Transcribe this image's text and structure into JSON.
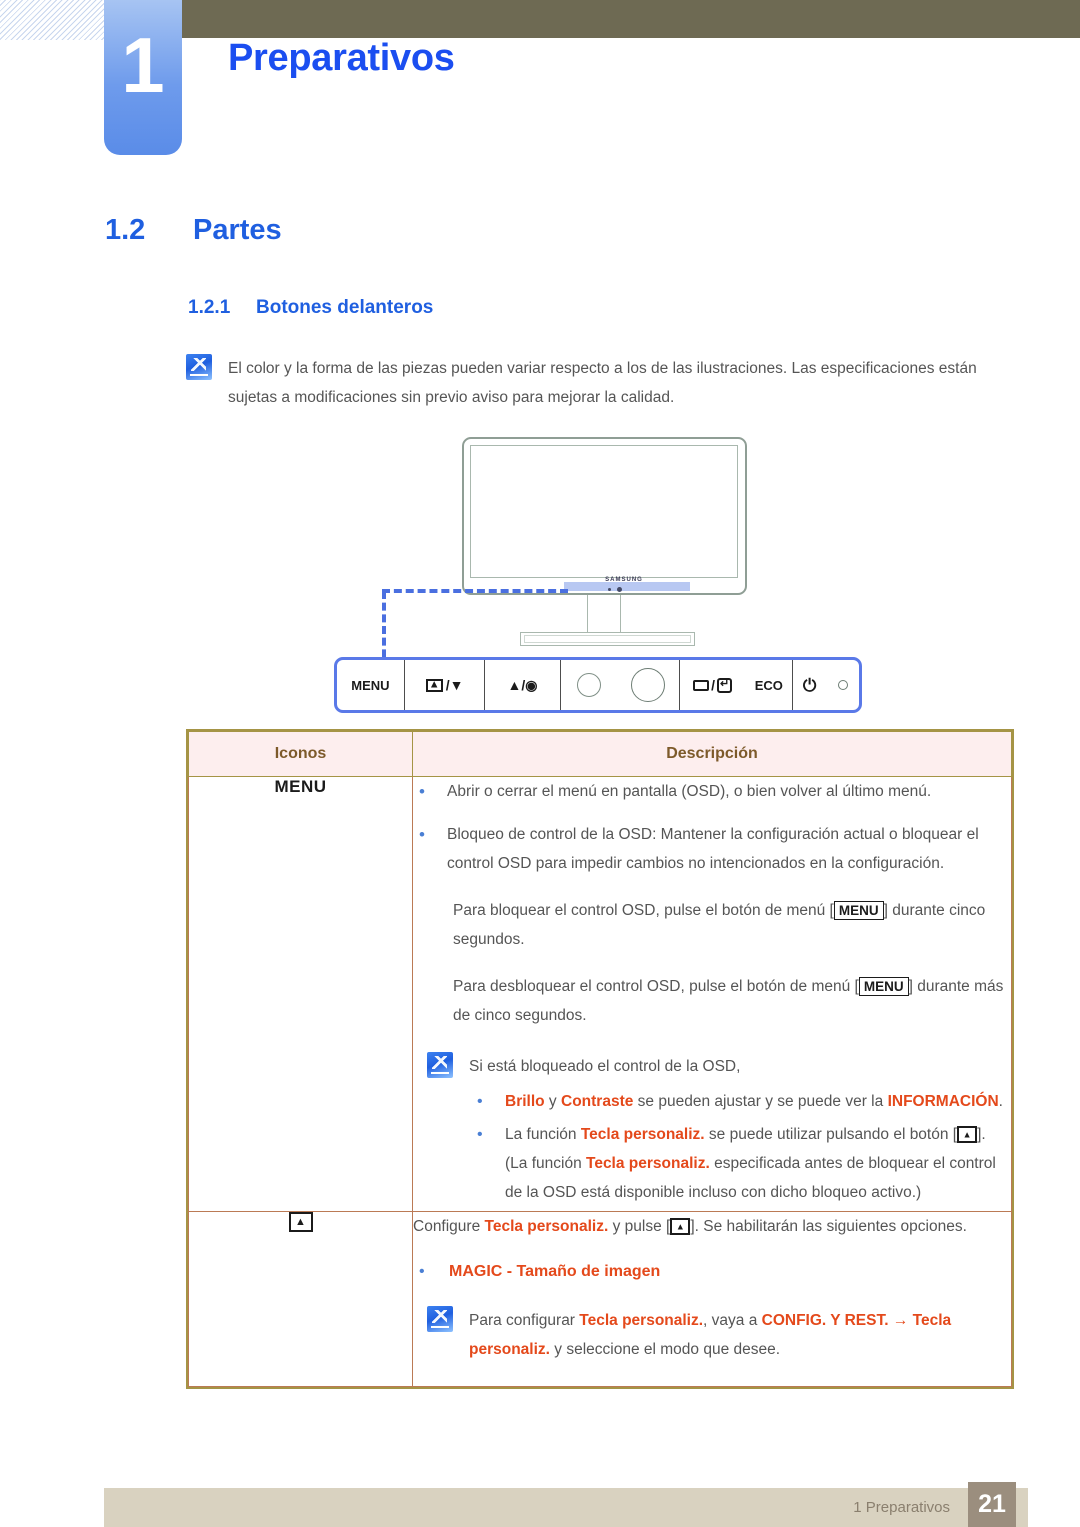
{
  "header": {
    "chapter_number": "1",
    "chapter_title": "Preparativos"
  },
  "headings": {
    "section_number": "1.2",
    "section_title": "Partes",
    "subsection_number": "1.2.1",
    "subsection_title": "Botones delanteros"
  },
  "top_note": {
    "icon": "note-pencil-icon",
    "text": "El color y la forma de las piezas pueden variar respecto a los de las ilustraciones. Las especificaciones están sujetas a modificaciones sin previo aviso para mejorar la calidad."
  },
  "illustration": {
    "brand": "SAMSUNG"
  },
  "button_bar": {
    "buttons": [
      {
        "id": "menu",
        "label": "MENU"
      },
      {
        "id": "custom-key-down",
        "label": "/▼",
        "icon": "custom-key-icon"
      },
      {
        "id": "up-enter",
        "label": "▲/◉",
        "icon": "up-arrow-icon"
      },
      {
        "id": "led-small",
        "label": "",
        "icon": "small-circle-icon"
      },
      {
        "id": "led-large",
        "label": "",
        "icon": "large-circle-icon"
      },
      {
        "id": "source-enter",
        "label": "/",
        "icon": "source-enter-icon"
      },
      {
        "id": "eco",
        "label": "ECO"
      },
      {
        "id": "power",
        "label": "⏻",
        "icon": "power-icon"
      },
      {
        "id": "indicator",
        "label": "",
        "icon": "indicator-dot-icon"
      }
    ]
  },
  "table": {
    "headers": {
      "icons": "Iconos",
      "description": "Descripción"
    },
    "rows": [
      {
        "icon_label": "MENU",
        "icon_type": "text",
        "bullets": [
          "Abrir o cerrar el menú en pantalla (OSD), o bien volver al último menú.",
          "Bloqueo de control de la OSD: Mantener la configuración actual o bloquear el control OSD para impedir cambios no intencionados en la configuración."
        ],
        "para_lock_pre": "Para bloquear el control OSD, pulse el botón de menú [",
        "para_lock_key": "MENU",
        "para_lock_post": "] durante cinco segundos.",
        "para_unlock_pre": "Para desbloquear el control OSD, pulse el botón de menú [",
        "para_unlock_key": "MENU",
        "para_unlock_post": "] durante más de cinco segundos.",
        "note": {
          "intro": "Si está bloqueado el control de la OSD,",
          "sub_bullets": [
            {
              "parts": [
                {
                  "t": "Brillo",
                  "style": "hl"
                },
                {
                  "t": " y ",
                  "style": "plain"
                },
                {
                  "t": "Contraste",
                  "style": "hl"
                },
                {
                  "t": " se pueden ajustar y se puede ver la ",
                  "style": "plain"
                },
                {
                  "t": "INFORMACIÓN",
                  "style": "hl"
                },
                {
                  "t": ".",
                  "style": "plain"
                }
              ]
            },
            {
              "parts": [
                {
                  "t": "La función ",
                  "style": "plain"
                },
                {
                  "t": "Tecla personaliz.",
                  "style": "hl"
                },
                {
                  "t": " se puede utilizar pulsando el botón [",
                  "style": "plain"
                },
                {
                  "t": "KEY",
                  "style": "key"
                },
                {
                  "t": "]. (La función ",
                  "style": "plain"
                },
                {
                  "t": "Tecla personaliz.",
                  "style": "hl"
                },
                {
                  "t": " especificada antes de bloquear el control de la OSD está disponible incluso con dicho bloqueo activo.)",
                  "style": "plain"
                }
              ]
            }
          ]
        }
      },
      {
        "icon_label": "",
        "icon_type": "custom-key-icon",
        "intro_parts": [
          {
            "t": "Configure ",
            "style": "plain"
          },
          {
            "t": "Tecla personaliz.",
            "style": "hl"
          },
          {
            "t": " y pulse [",
            "style": "plain"
          },
          {
            "t": "KEY",
            "style": "key"
          },
          {
            "t": "]. Se habilitarán las siguientes opciones.",
            "style": "plain"
          }
        ],
        "magic_item": "MAGIC - Tamaño de imagen",
        "note": {
          "parts": [
            {
              "t": "Para configurar ",
              "style": "plain"
            },
            {
              "t": "Tecla personaliz.",
              "style": "hl"
            },
            {
              "t": ", vaya a ",
              "style": "plain"
            },
            {
              "t": "CONFIG. Y REST. →",
              "style": "hl"
            },
            {
              "t": " ",
              "style": "plain"
            },
            {
              "t": "Tecla personaliz.",
              "style": "hl"
            },
            {
              "t": " y seleccione el modo que desee.",
              "style": "plain"
            }
          ]
        }
      }
    ]
  },
  "footer": {
    "label": "1 Preparativos",
    "page_number": "21"
  },
  "colors": {
    "heading_blue": "#1f5fe0",
    "title_blue": "#1b4ef0",
    "olive_bar": "#6e6a53",
    "table_border": "#a59445",
    "table_header_bg": "#fdeeee",
    "highlight_orange": "#e4491b",
    "footer_bar": "#d9d2c0",
    "footer_page_bg": "#9b8e7e"
  }
}
